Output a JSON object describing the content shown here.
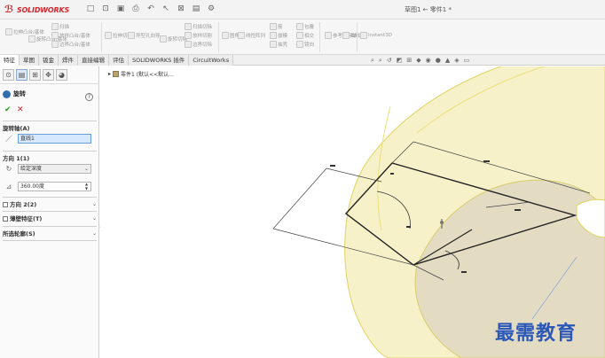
{
  "titlebar": {
    "brand": "SOLIDWORKS",
    "document_title": "草图1 ← 零件1 *"
  },
  "ribbon": {
    "items": [
      "拉伸凸台/基体",
      "旋转凸台/基体",
      "扫描",
      "放样凸台/基体",
      "边界凸台/基体",
      "拉伸切除",
      "异型孔向导",
      "旋转切除",
      "扫描切除",
      "放样切割",
      "边界切除",
      "圆角",
      "线性阵列",
      "筋",
      "包覆",
      "拔模",
      "相交",
      "抽壳",
      "镜向",
      "参考几何体",
      "曲线",
      "Instant3D"
    ]
  },
  "tabs": [
    "特征",
    "草图",
    "钣金",
    "焊件",
    "直接编辑",
    "评估",
    "SOLIDWORKS 插件",
    "CircuitWorks"
  ],
  "panel": {
    "title": "旋转",
    "help": "?",
    "ok": "✔",
    "cancel": "✕",
    "axis_section": "旋转轴(A)",
    "axis_value": "直线1",
    "direction_section": "方向 1(1)",
    "end_condition": "给定深度",
    "angle_value": "360.00度",
    "direction2_section": "方向 2(2)",
    "thin_feature_section": "薄壁特征(T)",
    "contours_section": "所选轮廓(S)"
  },
  "tree": {
    "root_label": "零件1 (默认<<默认..."
  },
  "watermark": {
    "text": "最需教育"
  }
}
